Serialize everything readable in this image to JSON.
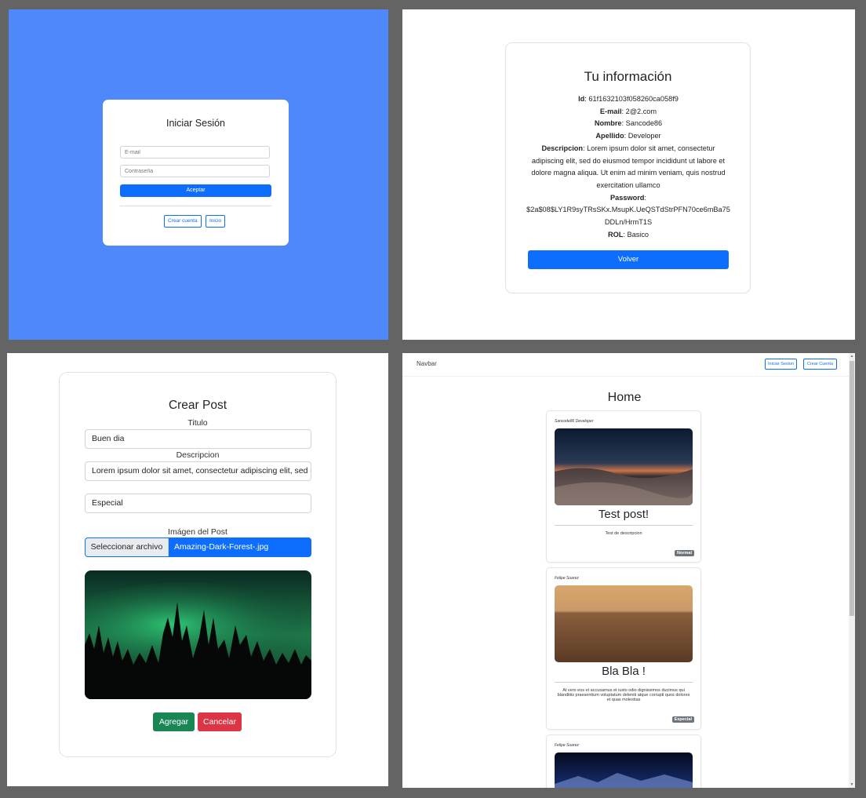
{
  "login": {
    "title": "Iniciar Sesión",
    "email_placeholder": "E-mail",
    "password_placeholder": "Contraseña",
    "submit_label": "Aceptar",
    "create_account_label": "Crear cuenta",
    "home_label": "Inicio"
  },
  "info": {
    "title": "Tu información",
    "fields": [
      {
        "label": "Id",
        "value": "61f1632103f058260ca058f9"
      },
      {
        "label": "E-mail",
        "value": "2@2.com"
      },
      {
        "label": "Nombre",
        "value": "Sancode86"
      },
      {
        "label": "Apellido",
        "value": "Developer"
      },
      {
        "label": "Descripcion",
        "value": "Lorem ipsum dolor sit amet, consectetur adipiscing elit, sed do eiusmod tempor incididunt ut labore et dolore magna aliqua. Ut enim ad minim veniam, quis nostrud exercitation ullamco"
      },
      {
        "label": "Password",
        "value": "$2a$08$LY1R9syTRsSKx.MsupK.UeQSTdStrPFN70ce6mBa75DDLn/HrmT1S"
      },
      {
        "label": "ROL",
        "value": "Basico"
      }
    ],
    "back_label": "Volver"
  },
  "create_post": {
    "title": "Crear Post",
    "titulo_label": "Titulo",
    "titulo_value": "Buen dia",
    "descripcion_label": "Descripcion",
    "descripcion_value": "Lorem ipsum dolor sit amet, consectetur adipiscing elit, sed do eiusmod",
    "tipo_value": "Especial",
    "image_label": "Imágen del Post",
    "file_button_label": "Seleccionar archivo",
    "file_name": "Amazing-Dark-Forest-.jpg",
    "add_label": "Agregar",
    "cancel_label": "Cancelar"
  },
  "home": {
    "navbar_brand": "Navbar",
    "login_label": "Iniciar Sesion",
    "signup_label": "Crear Cuenta",
    "title": "Home",
    "posts": [
      {
        "author": "Sancode86 Developer",
        "title": "Test post!",
        "description": "Test de descripcion",
        "badge": "Normal"
      },
      {
        "author": "Felipe Suarez",
        "title": "Bla Bla !",
        "description": "At vero eos et accusamus et iusto odio dignissimos ducimus qui blanditiis praesentium voluptatum deleniti atque corrupti quos dolores et quas molestias",
        "badge": "Especial"
      },
      {
        "author": "Felipe Suarez"
      }
    ]
  },
  "colors": {
    "primary": "#0d6efd",
    "login_background": "#4f88fb",
    "success": "#198754",
    "danger": "#dc3545",
    "badge": "#6c757d"
  }
}
